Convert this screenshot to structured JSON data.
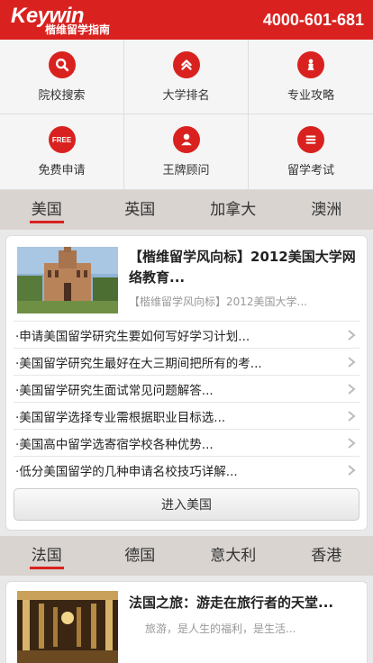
{
  "header": {
    "brand": "Keywin",
    "subtitle": "楷维留学指南",
    "phone": "4000-601-681"
  },
  "menu": [
    {
      "label": "院校搜索",
      "icon": "search-icon"
    },
    {
      "label": "大学排名",
      "icon": "rank-up-icon"
    },
    {
      "label": "专业攻略",
      "icon": "strategy-icon"
    },
    {
      "label": "免费申请",
      "icon": "free-icon",
      "badge": "FREE"
    },
    {
      "label": "王牌顾问",
      "icon": "consultant-icon"
    },
    {
      "label": "留学考试",
      "icon": "exam-menu-icon"
    }
  ],
  "tabs1": [
    "美国",
    "英国",
    "加拿大",
    "澳洲"
  ],
  "section1": {
    "featured_title": "【楷维留学风向标】2012美国大学网络教育...",
    "featured_summary": "【楷维留学风向标】2012美国大学...",
    "news": [
      "·申请美国留学研究生要如何写好学习计划...",
      "·美国留学研究生最好在大三期间把所有的考...",
      "·美国留学研究生面试常见问题解答...",
      "·美国留学选择专业需根据职业目标选...",
      "·美国高中留学选寄宿学校各种优势...",
      "·低分美国留学的几种申请名校技巧详解..."
    ],
    "enter_label": "进入美国"
  },
  "tabs2": [
    "法国",
    "德国",
    "意大利",
    "香港"
  ],
  "section2": {
    "featured_title": "法国之旅：游走在旅行者的天堂...",
    "featured_summary": "旅游，是人生的福利，是生活..."
  },
  "colors": {
    "accent": "#d9221f",
    "tab_bg": "#d9d4d0"
  }
}
